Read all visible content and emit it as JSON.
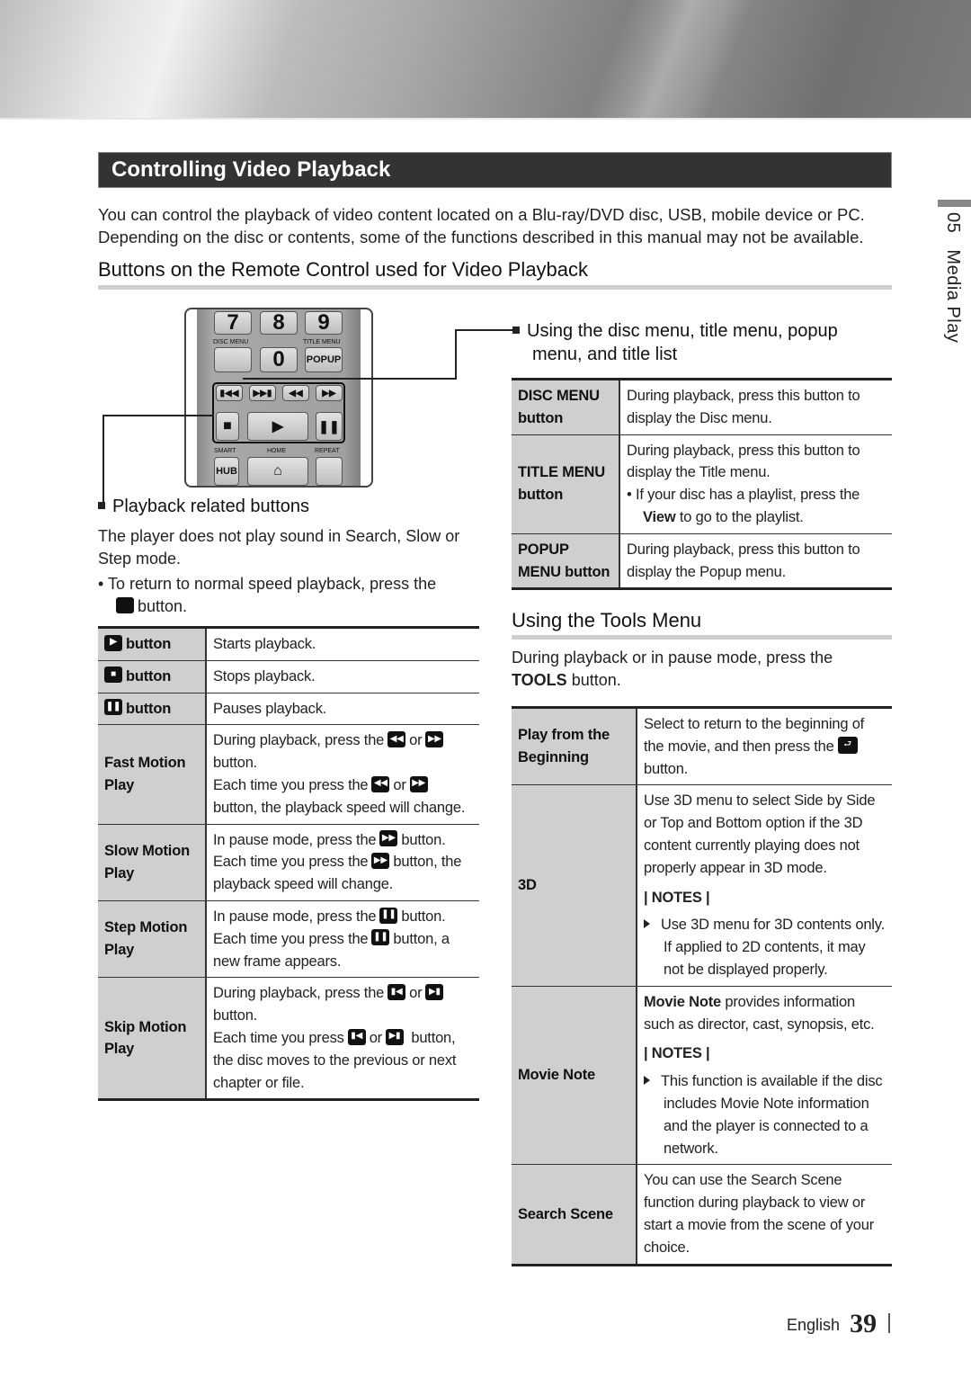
{
  "page": {
    "title": "Controlling Video Playback",
    "intro": "You can control the playback of video content located on a Blu-ray/DVD disc, USB, mobile device or PC. Depending on the disc or contents, some of the functions described in this manual may not be available.",
    "section_tab": {
      "number": "05",
      "label": "Media Play"
    },
    "footer": {
      "language": "English",
      "page_number": "39"
    }
  },
  "remote_section": {
    "heading": "Buttons on the Remote Control used for Video Playback",
    "remote_keys": {
      "digits": [
        "7",
        "8",
        "9",
        "0"
      ],
      "disc_menu_label": "DISC MENU",
      "title_menu_label": "TITLE MENU",
      "popup_label": "POPUP",
      "transport": [
        "skip-back-icon",
        "skip-forward-icon",
        "rewind-icon",
        "fast-forward-icon"
      ],
      "playback": [
        "stop-icon",
        "play-icon",
        "pause-icon"
      ],
      "smart_label": "SMART",
      "hub_label": "HUB",
      "home_label": "HOME",
      "repeat_label": "REPEAT"
    }
  },
  "playback_buttons": {
    "heading": "Playback related buttons",
    "note": "The player does not play sound in Search, Slow or Step mode.",
    "bullet_pre": "To return to normal speed playback, press the",
    "bullet_post": "button.",
    "rows": [
      {
        "key_icon": "play-icon",
        "key_label": "button",
        "desc": "Starts playback."
      },
      {
        "key_icon": "stop-icon",
        "key_label": "button",
        "desc": "Stops playback."
      },
      {
        "key_icon": "pause-icon",
        "key_label": "button",
        "desc": "Pauses playback."
      },
      {
        "key": "Fast Motion Play",
        "l1_pre": "During playback, press the",
        "l1_or": "or",
        "l1_post": "button.",
        "l2_pre": "Each time you press the",
        "l2_or": "or",
        "l2_post": "button, the playback speed will change."
      },
      {
        "key": "Slow Motion Play",
        "l1_pre": "In pause mode, press the",
        "l1_post": "button.",
        "l2_pre": "Each time you press the",
        "l2_post": "button, the playback speed will change."
      },
      {
        "key": "Step Motion Play",
        "l1_pre": "In pause mode, press the",
        "l1_post": "button.",
        "l2_pre": "Each time you press the",
        "l2_post": "button, a new frame appears."
      },
      {
        "key": "Skip Motion Play",
        "l1_pre": "During playback, press the",
        "l1_or": "or",
        "l1_post": "button.",
        "l2_pre": "Each time you press",
        "l2_or": "or",
        "l2_post": "button, the disc moves to the previous or next chapter or file."
      }
    ]
  },
  "menu_section": {
    "heading": "Using the disc menu, title menu, popup menu, and title list",
    "rows": [
      {
        "key": "DISC MENU button",
        "desc": "During playback, press this button to display the Disc menu."
      },
      {
        "key": "TITLE MENU button",
        "desc": "During playback, press this button to display the Title menu.",
        "bullet_pre": "If your disc has a playlist, press the",
        "bullet_bold": "View",
        "bullet_post": "to go to the playlist."
      },
      {
        "key": "POPUP MENU button",
        "desc": "During playback, press this button to display the Popup menu."
      }
    ]
  },
  "tools_section": {
    "heading": "Using the Tools Menu",
    "intro_pre": "During playback or in pause mode, press the",
    "intro_bold": "TOOLS",
    "intro_post": "button.",
    "rows": [
      {
        "key": "Play from the Beginning",
        "desc_pre": "Select to return to the beginning of the movie, and then press the",
        "desc_icon": "enter-icon",
        "desc_post": "button."
      },
      {
        "key": "3D",
        "desc": "Use 3D menu to select Side by Side or Top and Bottom option if the 3D content currently playing does not properly appear in 3D mode.",
        "notes_label": "| NOTES |",
        "note": "Use 3D menu for 3D contents only. If applied to 2D contents, it may not be displayed properly."
      },
      {
        "key": "Movie Note",
        "desc_bold": "Movie Note",
        "desc": "provides information such as director, cast, synopsis, etc.",
        "notes_label": "| NOTES |",
        "note": "This function is available if the disc includes Movie Note information and the player is connected to a network."
      },
      {
        "key": "Search Scene",
        "desc": "You can use the Search Scene function during playback to view or start a movie from the scene of your choice."
      }
    ]
  }
}
